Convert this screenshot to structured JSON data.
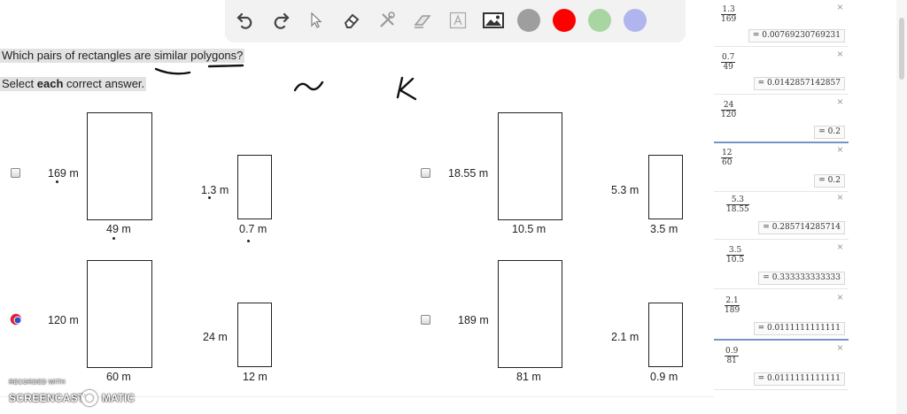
{
  "question": {
    "prompt": "Which pairs of rectangles are similar polygons?",
    "instruction_pre": "Select ",
    "instruction_bold": "each",
    "instruction_post": " correct answer."
  },
  "options": [
    {
      "big_height": "169 m",
      "big_width": "49 m",
      "small_height": "1.3 m",
      "small_width": "0.7 m"
    },
    {
      "big_height": "18.55 m",
      "big_width": "10.5 m",
      "small_height": "5.3 m",
      "small_width": "3.5 m"
    },
    {
      "big_height": "120 m",
      "big_width": "60 m",
      "small_height": "24 m",
      "small_width": "12 m"
    },
    {
      "big_height": "189 m",
      "big_width": "81 m",
      "small_height": "2.1 m",
      "small_width": "0.9 m"
    }
  ],
  "calculator": [
    {
      "num": "1.3",
      "den": "169",
      "result": "= 0.00769230769231"
    },
    {
      "num": "0.7",
      "den": "49",
      "result": "= 0.0142857142857"
    },
    {
      "num": "24",
      "den": "120",
      "result": "= 0.2"
    },
    {
      "num": "12",
      "den": "60",
      "result": "= 0.2"
    },
    {
      "num": "5.3",
      "den": "18.55",
      "result": "= 0.285714285714"
    },
    {
      "num": "3.5",
      "den": "10.5",
      "result": "= 0.333333333333"
    },
    {
      "num": "2.1",
      "den": "189",
      "result": "= 0.0111111111111"
    },
    {
      "num": "0.9",
      "den": "81",
      "result": "= 0.0111111111111"
    }
  ],
  "toolbar": {
    "tools": [
      "undo-icon",
      "redo-icon",
      "cursor-icon",
      "eraser-icon",
      "tools-icon",
      "highlighter-icon",
      "text-icon",
      "image-icon"
    ],
    "colors": [
      "#9e9e9e",
      "#ff0000",
      "#a8d5a2",
      "#b0b5ee"
    ]
  },
  "watermark": {
    "recorded": "RECORDED WITH",
    "brand_left": "SCREENCAST",
    "brand_right": "MATIC"
  },
  "close_symbol": "×"
}
